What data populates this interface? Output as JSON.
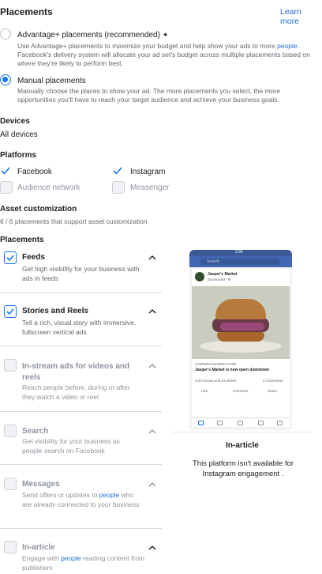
{
  "header": {
    "title": "Placements",
    "learn_more": "Learn more"
  },
  "advantage": {
    "label": "Advantage+ placements (recommended)",
    "sparkle": "✦",
    "desc_prefix": "Use Advantage+ placements to maximize your budget and help show your ads to more ",
    "desc_link": "people",
    "desc_suffix": ". Facebook's delivery system will allocate your ad set's budget across multiple placements based on where they're likely to perform best."
  },
  "manual": {
    "label": "Manual placements",
    "desc": "Manually choose the places to show your ad. The more placements you select, the more opportunities you'll have to reach your target audience and achieve your business goals."
  },
  "devices": {
    "heading": "Devices",
    "value": "All devices"
  },
  "platforms": {
    "heading": "Platforms",
    "items": [
      {
        "label": "Facebook",
        "checked": true
      },
      {
        "label": "Instagram",
        "checked": true
      },
      {
        "label": "Audience network",
        "checked": false
      },
      {
        "label": "Messenger",
        "checked": false
      }
    ]
  },
  "asset": {
    "heading": "Asset customization",
    "desc": "6 / 6 placements that support asset customization"
  },
  "placements": {
    "heading": "Placements",
    "items": [
      {
        "title": "Feeds",
        "desc": "Get high visibility for your business with ads in feeds",
        "checked": true
      },
      {
        "title": "Stories and Reels",
        "desc": "Tell a rich, visual story with immersive, fullscreen vertical ads",
        "checked": true
      },
      {
        "title": "In-stream ads for videos and reels",
        "desc": "Reach people before, during or after they watch a video or reel",
        "checked": false
      },
      {
        "title": "Search",
        "desc": "Get visibility for your business as people search on Facebook",
        "checked": false
      },
      {
        "title": "Messages",
        "desc_prefix": "Send offers or updates to ",
        "desc_link": "people",
        "desc_suffix": " who are already connected to your business",
        "checked": false
      },
      {
        "title": "In-article",
        "desc_prefix": "Engage with ",
        "desc_link": "people",
        "desc_suffix": " reading content from publishers",
        "checked": false
      }
    ]
  },
  "preview": {
    "status_time": "2:30",
    "search": "Search",
    "page_name": "Jasper's Market",
    "sponsored": "Sponsored · ⚙",
    "site": "JASPERS-MARKET.COM",
    "headline": "Jasper's Market is now open downtown",
    "reactions": "John Evans and 23 others",
    "comments": "2 Comments",
    "like": "Like",
    "comment": "Comment",
    "share": "Share",
    "caption_title": "In-article",
    "caption_text": "This platform isn't available for Instagram engagement ."
  }
}
